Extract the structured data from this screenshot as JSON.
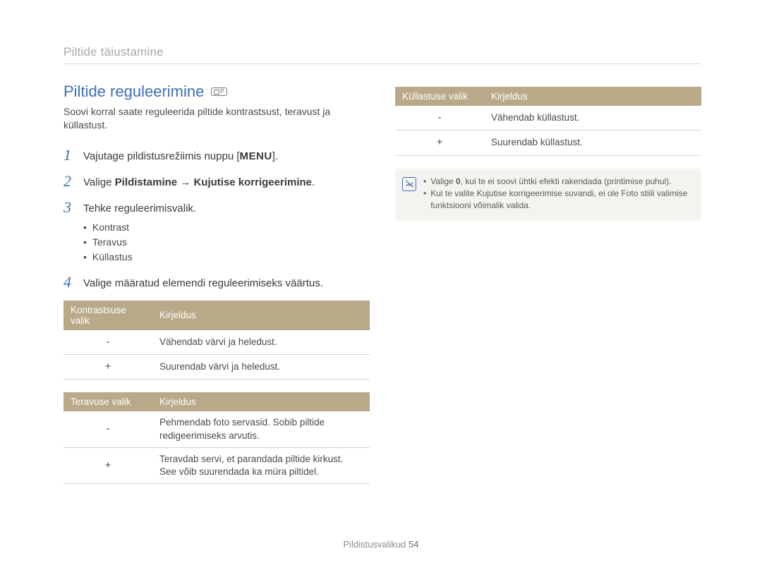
{
  "breadcrumb": "Piltide täiustamine",
  "section_title": "Piltide reguleerimine",
  "mode_badge": "P",
  "intro": "Soovi korral saate reguleerida piltide kontrastsust, teravust ja küllastust.",
  "steps": [
    {
      "num": "1",
      "prefix": "Vajutage pildistusrežiimis nuppu [",
      "key": "MENU",
      "suffix": "]."
    },
    {
      "num": "2",
      "prefix": "Valige ",
      "bold": "Pildistamine → Kujutise korrigeerimine",
      "suffix": "."
    },
    {
      "num": "3",
      "text": "Tehke reguleerimisvalik.",
      "bullets": [
        "Kontrast",
        "Teravus",
        "Küllastus"
      ]
    },
    {
      "num": "4",
      "text": "Valige määratud elemendi reguleerimiseks väärtus."
    }
  ],
  "tables": {
    "kontrast": {
      "headers": [
        "Kontrastsuse valik",
        "Kirjeldus"
      ],
      "rows": [
        [
          "-",
          "Vähendab värvi ja heledust."
        ],
        [
          "+",
          "Suurendab värvi ja heledust."
        ]
      ]
    },
    "teravus": {
      "headers": [
        "Teravuse valik",
        "Kirjeldus"
      ],
      "rows": [
        [
          "-",
          "Pehmendab foto servasid. Sobib piltide redigeerimiseks arvutis."
        ],
        [
          "+",
          "Teravdab servi, et parandada piltide kirkust. See võib suurendada ka müra piltidel."
        ]
      ]
    },
    "kyllastus": {
      "headers": [
        "Küllastuse valik",
        "Kirjeldus"
      ],
      "rows": [
        [
          "-",
          "Vähendab küllastust."
        ],
        [
          "+",
          "Suurendab küllastust."
        ]
      ]
    }
  },
  "notes": [
    {
      "pre": "Valige ",
      "b": "0",
      "post": ", kui te ei soovi ühtki efekti rakendada (printimise puhul)."
    },
    {
      "text": "Kui te valite Kujutise korrigeerimise suvandi, ei ole Foto stiili valimise funktsiooni võimalik valida."
    }
  ],
  "footer": {
    "label": "Pildistusvalikud",
    "page": "54"
  }
}
